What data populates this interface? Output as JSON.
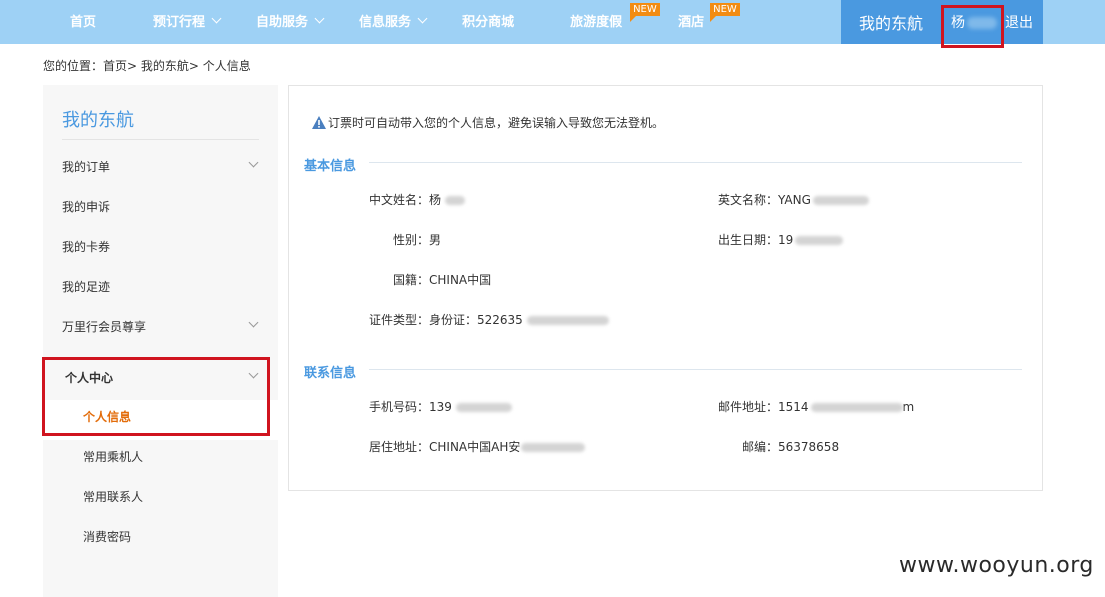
{
  "nav": {
    "items": [
      {
        "label": "首页",
        "dropdown": false
      },
      {
        "label": "预订行程",
        "dropdown": true
      },
      {
        "label": "自助服务",
        "dropdown": true
      },
      {
        "label": "信息服务",
        "dropdown": true
      },
      {
        "label": "积分商城",
        "dropdown": false
      },
      {
        "label": "旅游度假",
        "dropdown": false,
        "badge": "NEW"
      },
      {
        "label": "酒店",
        "dropdown": false,
        "badge": "NEW"
      }
    ],
    "mine_label": "我的东航",
    "user_surname": "杨",
    "logout_label": "退出"
  },
  "breadcrumb": "您的位置：首页> 我的东航> 个人信息",
  "sidebar": {
    "title": "我的东航",
    "items": [
      {
        "label": "我的订单",
        "expandable": true
      },
      {
        "label": "我的申诉",
        "expandable": false
      },
      {
        "label": "我的卡券",
        "expandable": false
      },
      {
        "label": "我的足迹",
        "expandable": false
      },
      {
        "label": "万里行会员尊享",
        "expandable": true
      },
      {
        "label": "个人中心",
        "expandable": true
      }
    ],
    "subitems": [
      {
        "label": "个人信息",
        "active": true
      },
      {
        "label": "常用乘机人",
        "active": false
      },
      {
        "label": "常用联系人",
        "active": false
      },
      {
        "label": "消费密码",
        "active": false
      }
    ]
  },
  "main": {
    "notice": "订票时可自动带入您的个人信息，避免误输入导致您无法登机。",
    "basic_title": "基本信息",
    "contact_title": "联系信息",
    "fields": {
      "cn_name": "中文姓名：杨",
      "en_name": "英文名称：YANG",
      "gender": "性别：男",
      "birthday": "出生日期：19",
      "nationality": "国籍：CHINA中国",
      "id_type": "证件类型：身份证：522635",
      "phone": "手机号码：139",
      "email_prefix": "邮件地址：1514",
      "email_suffix": "m",
      "address": "居住地址：CHINA中国AH安",
      "zipcode": "邮编：56378658"
    }
  },
  "watermark": "www.wooyun.org",
  "colors": {
    "nav_bg": "#9ed1f5",
    "nav_active": "#4a99e0",
    "accent_blue": "#4a99e0",
    "highlight_red": "#d0141f",
    "active_orange": "#e36c0a",
    "badge_orange": "#f28c13"
  }
}
